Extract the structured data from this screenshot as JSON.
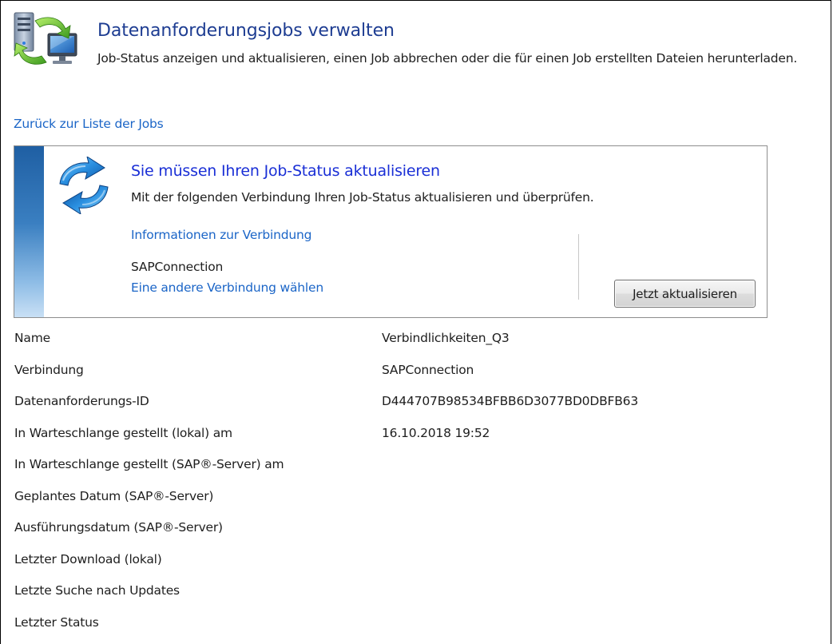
{
  "header": {
    "icon": "server-sync-icon",
    "title": "Datenanforderungsjobs verwalten",
    "description": "Job-Status anzeigen und aktualisieren, einen Job abbrechen oder die für einen Job erstellten Dateien herunterladen."
  },
  "back_link": "Zurück zur Liste der Jobs",
  "panel": {
    "icon": "refresh-arrows-icon",
    "title": "Sie müssen Ihren Job-Status aktualisieren",
    "description": "Mit der folgenden Verbindung Ihren Job-Status aktualisieren und überprüfen.",
    "connection_info_link": "Informationen zur Verbindung",
    "connection_name": "SAPConnection",
    "change_connection_link": "Eine andere Verbindung wählen",
    "refresh_button": "Jetzt aktualisieren"
  },
  "properties": [
    {
      "label": "Name",
      "value": "Verbindlichkeiten_Q3"
    },
    {
      "label": "Verbindung",
      "value": "SAPConnection"
    },
    {
      "label": "Datenanforderungs-ID",
      "value": "D444707B98534BFBB6D3077BD0DBFB63"
    },
    {
      "label": "In Warteschlange gestellt (lokal) am",
      "value": "16.10.2018 19:52"
    },
    {
      "label": "In Warteschlange gestellt (SAP®-Server) am",
      "value": ""
    },
    {
      "label": "Geplantes Datum (SAP®-Server)",
      "value": ""
    },
    {
      "label": "Ausführungsdatum (SAP®-Server)",
      "value": ""
    },
    {
      "label": "Letzter Download (lokal)",
      "value": ""
    },
    {
      "label": "Letzte Suche nach Updates",
      "value": ""
    },
    {
      "label": "Letzter Status",
      "value": ""
    }
  ],
  "colors": {
    "title": "#1e3d92",
    "link": "#1b65c7",
    "panel_title": "#1a2fd6"
  }
}
